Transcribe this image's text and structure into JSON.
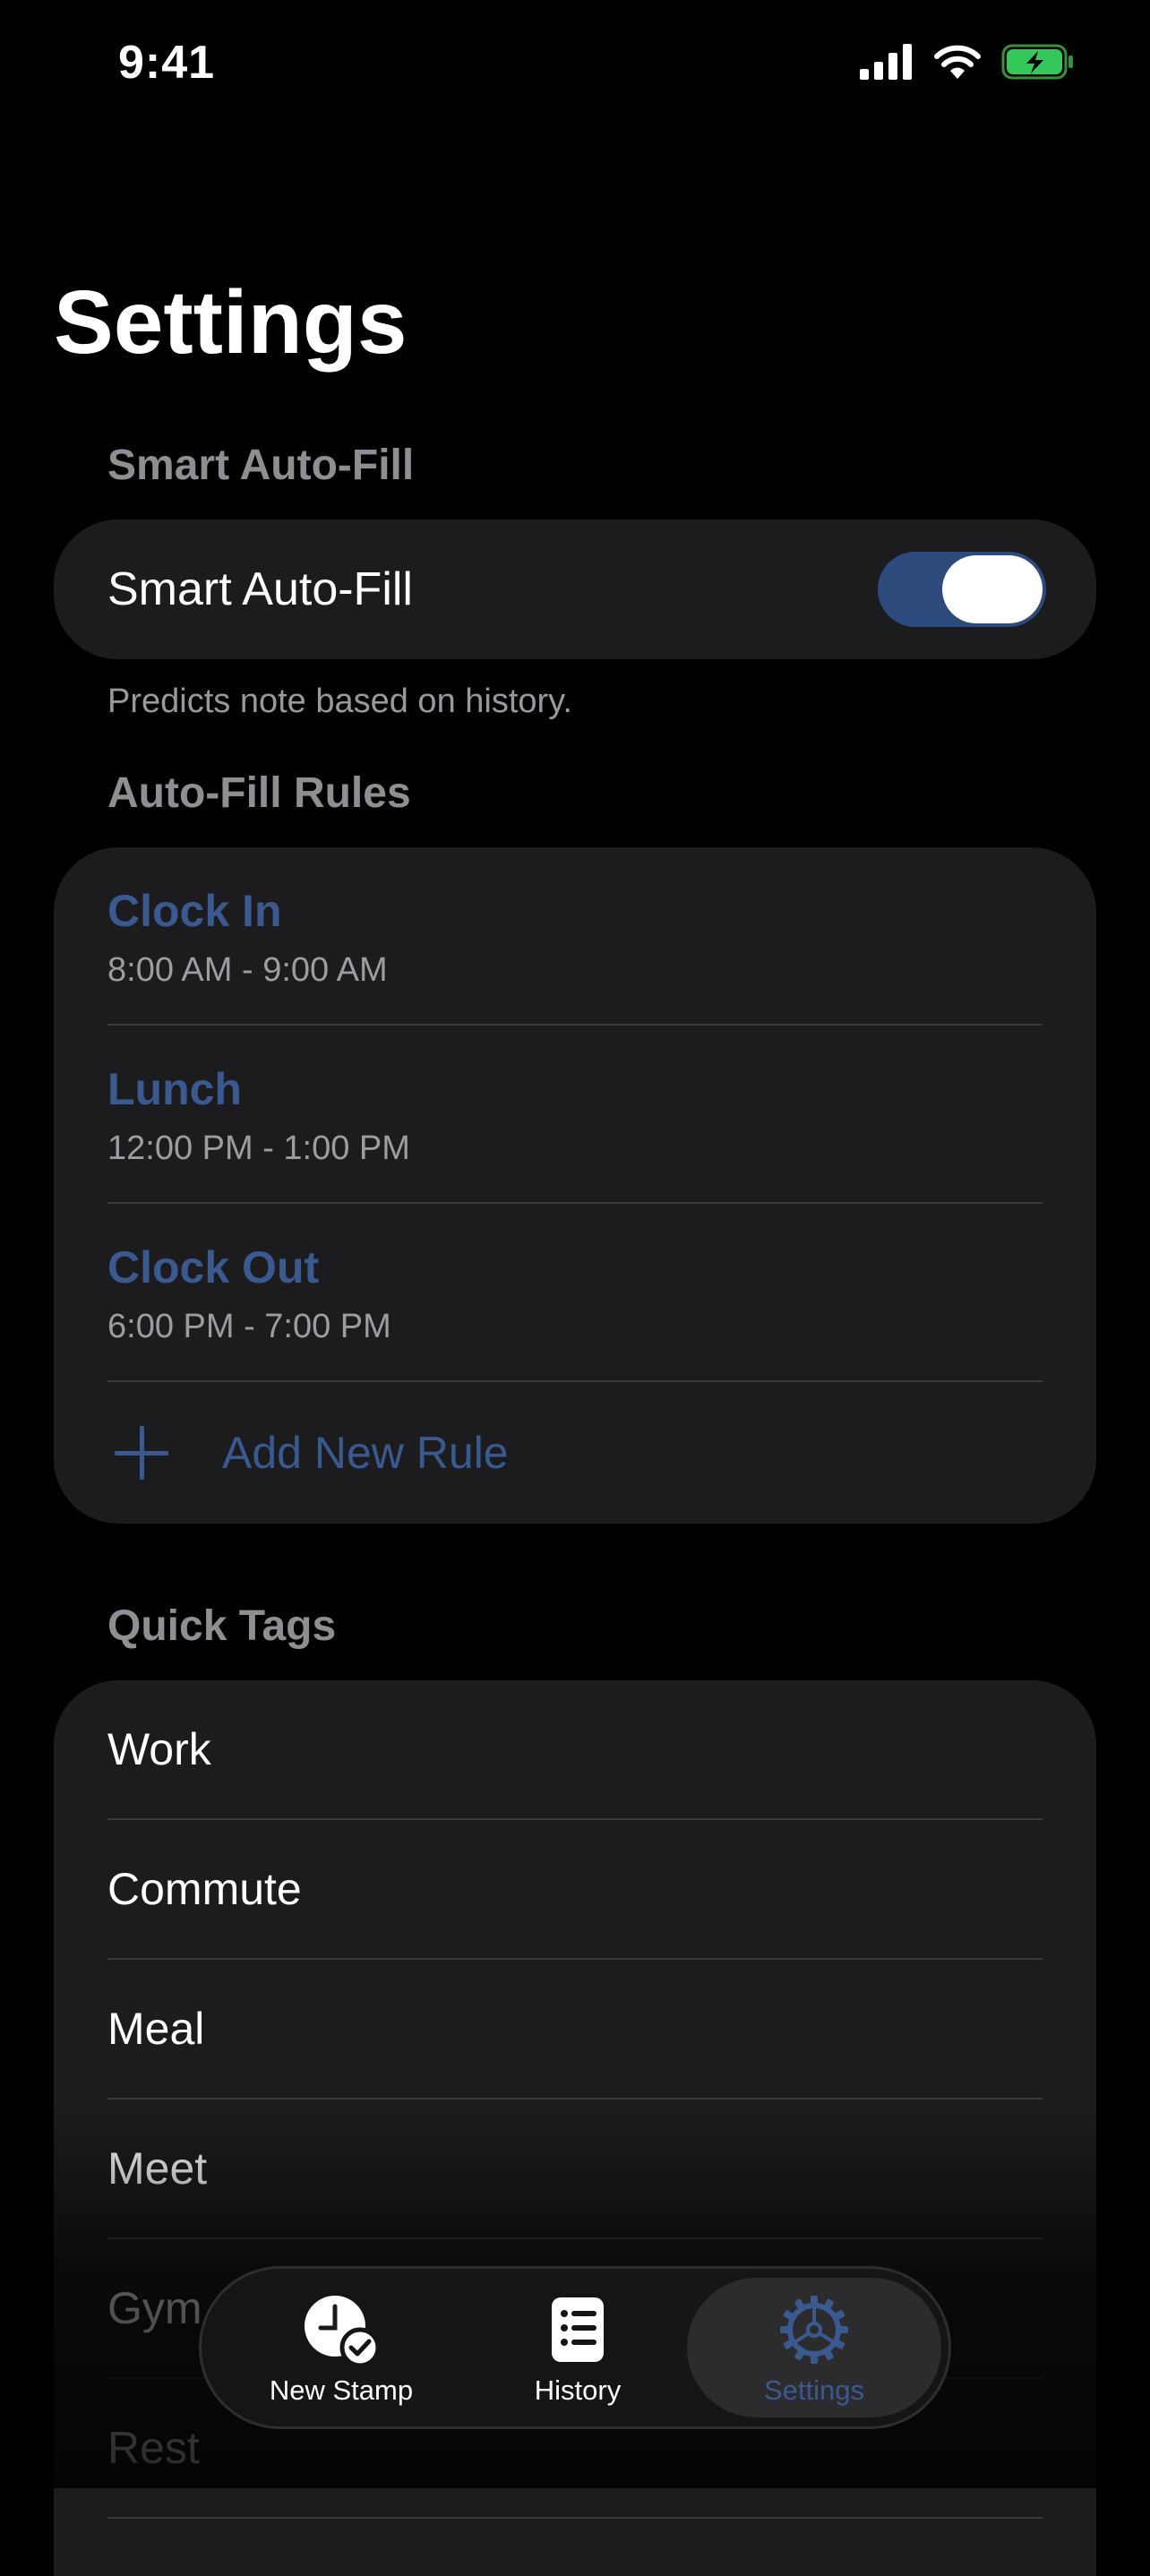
{
  "status_bar": {
    "time": "9:41",
    "icons": [
      "cellular-signal-icon",
      "wifi-icon",
      "battery-charging-icon"
    ]
  },
  "page": {
    "title": "Settings"
  },
  "smart_autofill": {
    "header": "Smart Auto-Fill",
    "toggle_label": "Smart Auto-Fill",
    "enabled": true,
    "footnote": "Predicts note based on history."
  },
  "rules": {
    "header": "Auto-Fill Rules",
    "items": [
      {
        "title": "Clock In",
        "time": "8:00 AM - 9:00 AM"
      },
      {
        "title": "Lunch",
        "time": "12:00 PM - 1:00 PM"
      },
      {
        "title": "Clock Out",
        "time": "6:00 PM - 7:00 PM"
      }
    ],
    "add_label": "Add New Rule"
  },
  "tags": {
    "header": "Quick Tags",
    "items": [
      "Work",
      "Commute",
      "Meal",
      "Meet",
      "Gym",
      "Rest"
    ]
  },
  "tab_bar": {
    "tabs": [
      {
        "label": "New Stamp",
        "icon": "clock-check-icon"
      },
      {
        "label": "History",
        "icon": "list-icon"
      },
      {
        "label": "Settings",
        "icon": "gear-icon"
      }
    ],
    "selected": "Settings"
  },
  "colors": {
    "background": "#000000",
    "card": "#1c1c1e",
    "accent": "#3a5a8f",
    "toggle_on": "#2c4a7c",
    "secondary_text": "#8e8e93",
    "separator": "#3a3a3c"
  }
}
